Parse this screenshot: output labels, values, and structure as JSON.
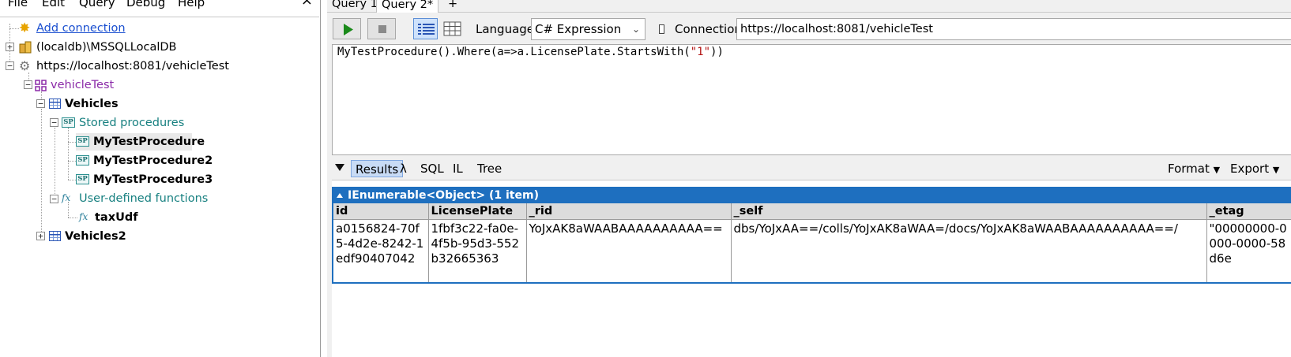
{
  "menu": {
    "file": "File",
    "edit": "Edit",
    "query": "Query",
    "debug": "Debug",
    "help": "Help",
    "close": "×"
  },
  "tree": {
    "add_connection": "Add connection",
    "localdb": "(localdb)\\MSSQLLocalDB",
    "endpoint": "https://localhost:8081/vehicleTest",
    "database": "vehicleTest",
    "container": "Vehicles",
    "stored_procedures": "Stored procedures",
    "procedures": [
      "MyTestProcedure",
      "MyTestProcedure2",
      "MyTestProcedure3"
    ],
    "udfs": "User-defined functions",
    "udf": "taxUdf",
    "container2": "Vehicles2",
    "sp_badge": "SP",
    "fx_badge": "fx"
  },
  "tabs": [
    "Query 1",
    "Query 2*",
    "+"
  ],
  "toolbar": {
    "language_label": "Language",
    "language_value": "C# Expression",
    "connection_label": "Connection",
    "connection_value": "https://localhost:8081/vehicleTest"
  },
  "editor": {
    "code_prefix": "MyTestProcedure().Where(a=>a.LicensePlate.StartsWith(",
    "code_string": "\"1\"",
    "code_suffix": "))"
  },
  "result_tabs": {
    "results": "Results",
    "lambda": "λ",
    "sql": "SQL",
    "il": "IL",
    "tree": "Tree",
    "format": "Format",
    "export": "Export"
  },
  "results": {
    "title": "IEnumerable<Object> (1 item)",
    "columns": [
      "id",
      "LicensePlate",
      "_rid",
      "_self",
      "_etag"
    ],
    "rows": [
      [
        "a0156824-70f5-4d2e-8242-1edf90407042",
        "1fbf3c22-fa0e-4f5b-95d3-552b32665363",
        "YoJxAK8aWAABAAAAAAAAAA==",
        "dbs/YoJxAA==/colls/YoJxAK8aWAA=/docs/YoJxAK8aWAABAAAAAAAAAA==/",
        "\"00000000-0000-0000-58d6e"
      ]
    ]
  },
  "colors": {
    "accent": "#1e6fbf",
    "link": "#1a4fd0",
    "db": "#8b2aa8",
    "teal": "#178080",
    "run": "#1a8a1a"
  }
}
